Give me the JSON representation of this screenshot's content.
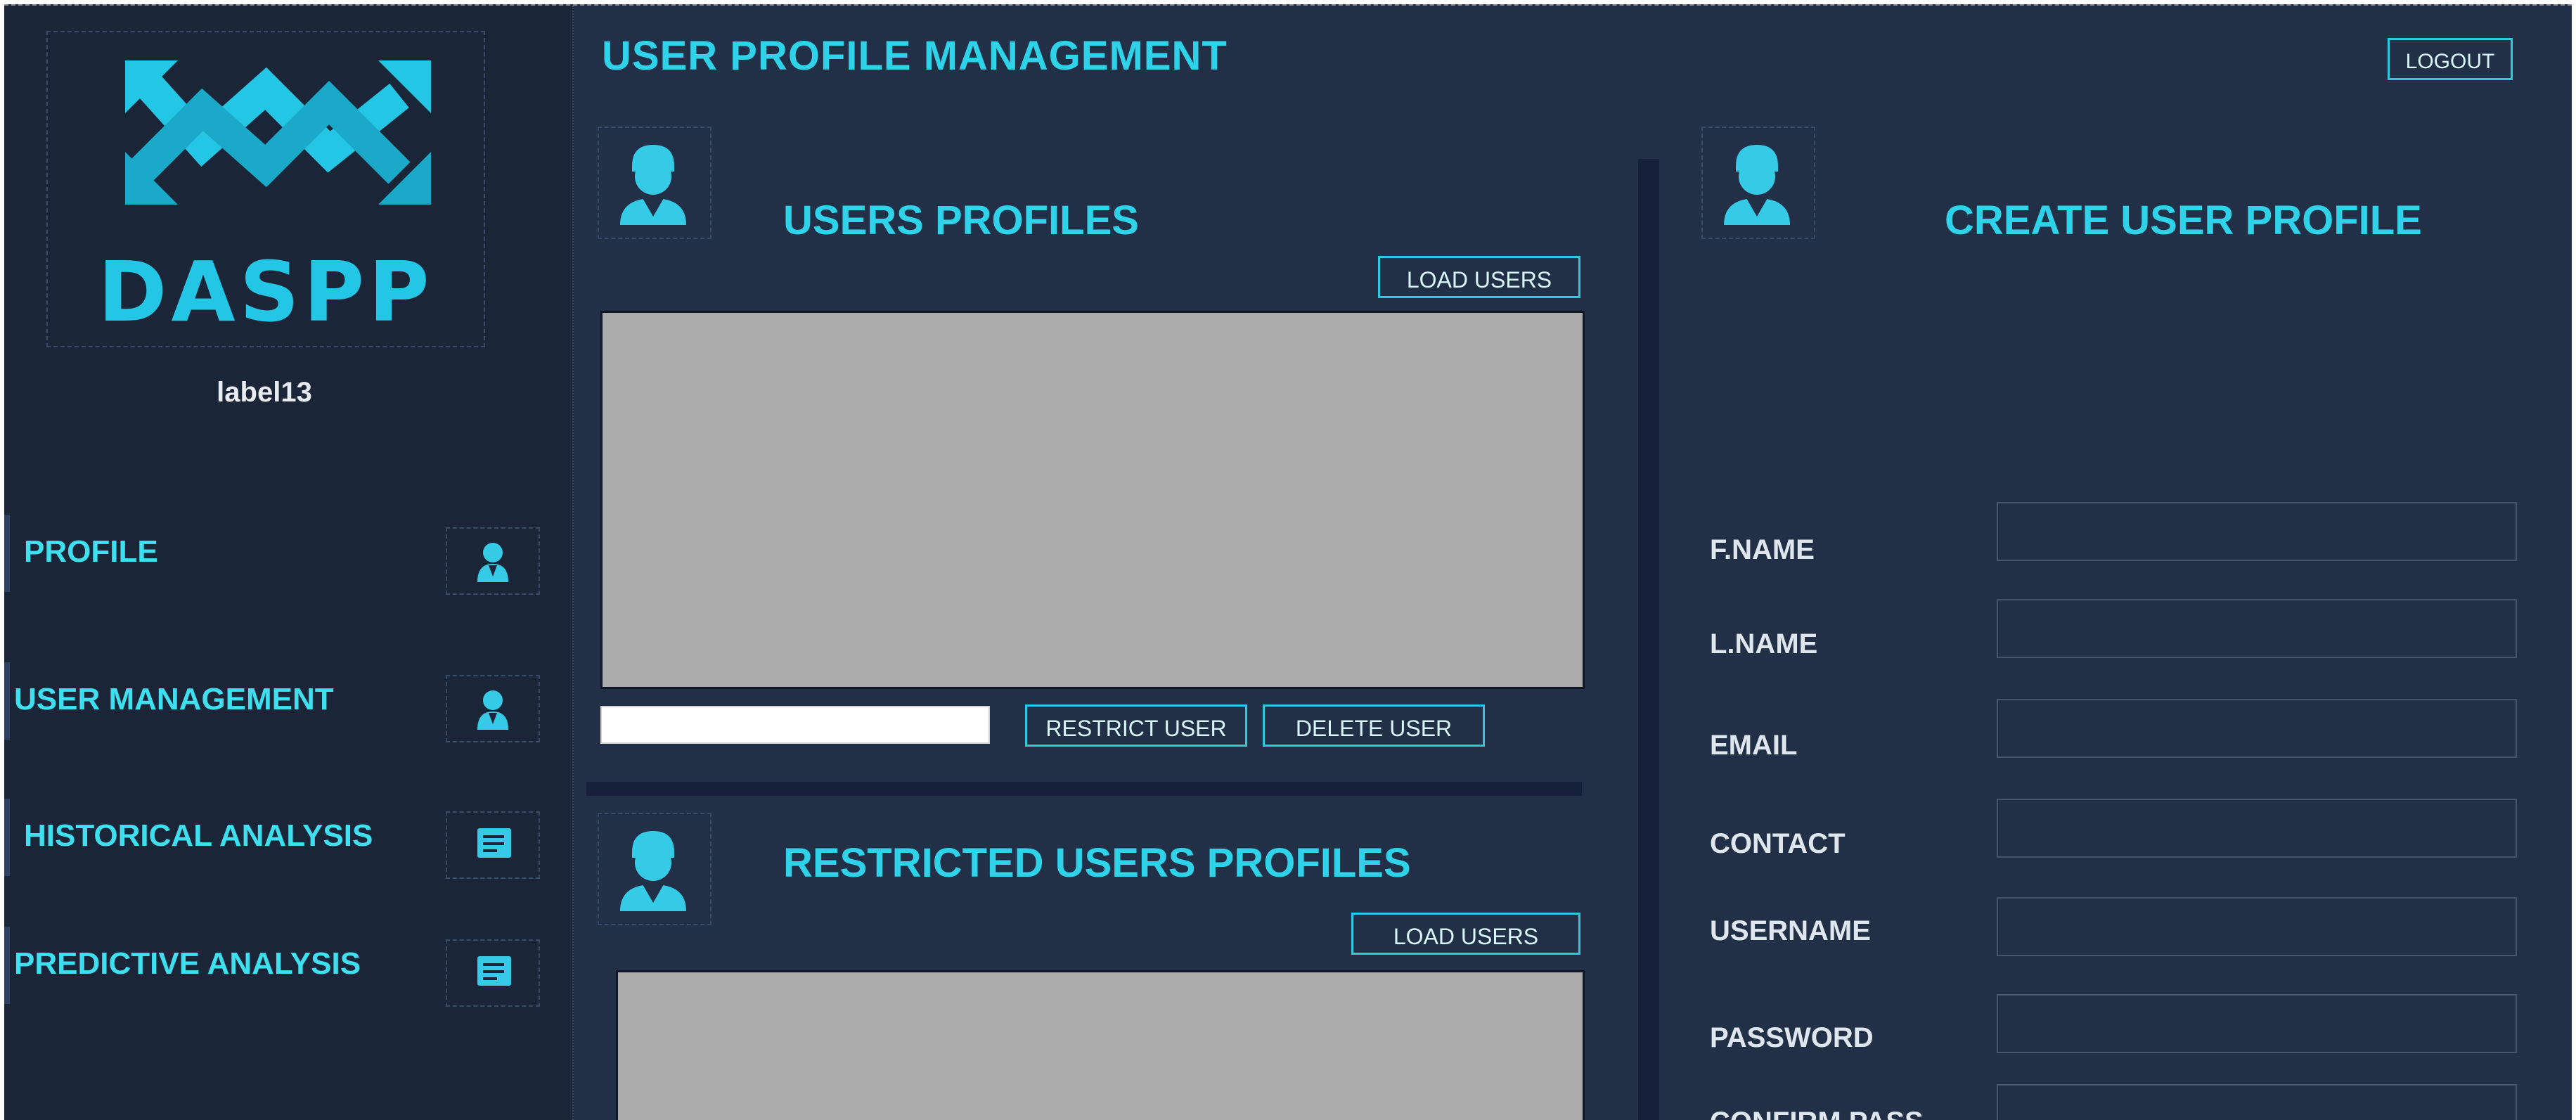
{
  "brand": {
    "logo_text": "DASPP",
    "user_label": "label13"
  },
  "sidebar": {
    "items": [
      {
        "label": "PROFILE",
        "icon": "user-icon"
      },
      {
        "label": "USER MANAGEMENT",
        "icon": "user-icon"
      },
      {
        "label": "HISTORICAL ANALYSIS",
        "icon": "document-icon"
      },
      {
        "label": "PREDICTIVE ANALYSIS",
        "icon": "document-icon"
      }
    ]
  },
  "header": {
    "title": "USER PROFILE MANAGEMENT",
    "logout_label": "LOGOUT"
  },
  "users_panel": {
    "title": "USERS PROFILES",
    "load_label": "LOAD USERS",
    "restrict_label": "RESTRICT USER",
    "delete_label": "DELETE USER",
    "input_value": ""
  },
  "restricted_panel": {
    "title": "RESTRICTED USERS PROFILES",
    "load_label": "LOAD USERS"
  },
  "create_panel": {
    "title": "CREATE USER PROFILE",
    "fields": [
      {
        "label": "F.NAME",
        "value": ""
      },
      {
        "label": "L.NAME",
        "value": ""
      },
      {
        "label": "EMAIL",
        "value": ""
      },
      {
        "label": "CONTACT",
        "value": ""
      },
      {
        "label": "USERNAME",
        "value": ""
      },
      {
        "label": "PASSWORD",
        "value": ""
      },
      {
        "label": "CONFIRM PASS",
        "value": ""
      }
    ]
  },
  "colors": {
    "accent": "#2ed3ea",
    "sidebar_bg": "#1b2538",
    "main_bg": "#213047",
    "grid_bg": "#ababab"
  }
}
